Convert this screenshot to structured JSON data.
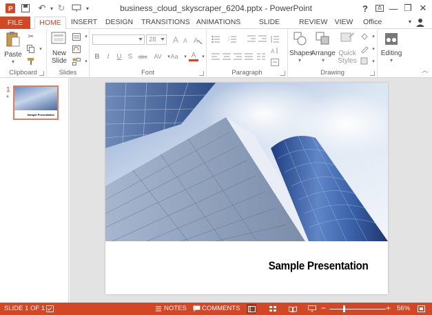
{
  "window": {
    "title": "business_cloud_skyscraper_6204.pptx - PowerPoint",
    "help": "?",
    "minimize": "—",
    "restore": "❐",
    "close": "✕"
  },
  "tabs": {
    "file": "FILE",
    "items": [
      "HOME",
      "INSERT",
      "DESIGN",
      "TRANSITIONS",
      "ANIMATIONS",
      "SLIDE SHOW",
      "REVIEW",
      "VIEW"
    ],
    "active": "HOME",
    "user": "Office Tutori..."
  },
  "ribbon": {
    "clipboard": {
      "paste": "Paste",
      "label": "Clipboard"
    },
    "slides": {
      "new_slide_line1": "New",
      "new_slide_line2": "Slide",
      "label": "Slides"
    },
    "font": {
      "size": "28",
      "bold": "B",
      "italic": "I",
      "underline": "U",
      "strike": "S",
      "abc": "abc",
      "spacing": "AV",
      "case": "Aa",
      "color": "A",
      "grow": "A",
      "shrink": "A",
      "label": "Font"
    },
    "paragraph": {
      "label": "Paragraph"
    },
    "drawing": {
      "shapes": "Shapes",
      "arrange": "Arrange",
      "quick_line1": "Quick",
      "quick_line2": "Styles",
      "label": "Drawing"
    },
    "editing": {
      "label": "Editing"
    }
  },
  "thumbnails": {
    "slide_number": "1",
    "star": "*",
    "thumb_title": "Sample Presentation"
  },
  "slide": {
    "title": "Sample Presentation"
  },
  "status": {
    "slide_info": "SLIDE 1 OF 1",
    "notes": "NOTES",
    "comments": "COMMENTS",
    "zoom_minus": "−",
    "zoom_plus": "+",
    "zoom": "56%"
  },
  "colors": {
    "accent": "#d24726",
    "sky": "#d8e4f2",
    "glass_blue": "#3f62a8"
  }
}
